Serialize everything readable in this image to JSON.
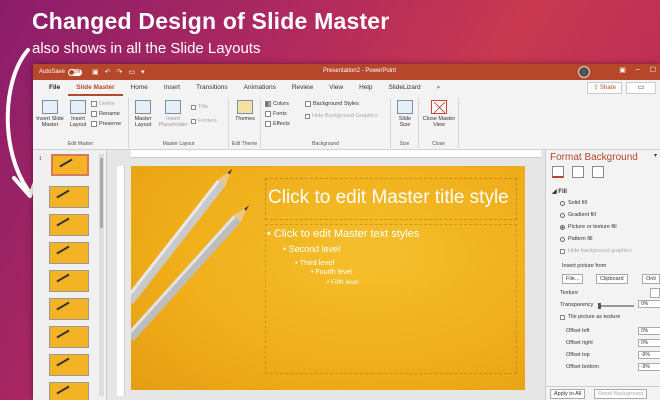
{
  "overlay": {
    "headline": "Changed Design of Slide Master",
    "subline": "also shows in all the Slide Layouts"
  },
  "titlebar": {
    "autosave_label": "AutoSave",
    "autosave_state": "Off",
    "doc_title": "Presentation2 - PowerPoint"
  },
  "tabs": [
    "File",
    "Slide Master",
    "Home",
    "Insert",
    "Transitions",
    "Animations",
    "Review",
    "View",
    "Help",
    "SlideLizard"
  ],
  "tell_me": "",
  "share_label": "Share",
  "ribbon": {
    "edit_master": {
      "label": "Edit Master",
      "insert_slide_master": "Insert Slide Master",
      "insert_layout": "Insert Layout",
      "delete": "Delete",
      "rename": "Rename",
      "preserve": "Preserve"
    },
    "master_layout": {
      "label": "Master Layout",
      "master_layout": "Master Layout",
      "insert_placeholder": "Insert Placeholder",
      "title": "Title",
      "footers": "Footers"
    },
    "edit_theme": {
      "label": "Edit Theme",
      "themes": "Themes"
    },
    "background": {
      "label": "Background",
      "colors": "Colors",
      "fonts": "Fonts",
      "effects": "Effects",
      "background_styles": "Background Styles",
      "hide_background_graphics": "Hide Background Graphics"
    },
    "size": {
      "label": "Size",
      "slide_size": "Slide Size"
    },
    "close": {
      "label": "Close",
      "close_master_view": "Close Master View"
    }
  },
  "slide": {
    "title": "Click to edit Master title style",
    "levels": [
      "Click to edit Master text styles",
      "Second level",
      "Third level",
      "Fourth level",
      "Fifth level"
    ],
    "footer_left": "",
    "footer_mid": "",
    "footer_right": ""
  },
  "thumb_number": "1",
  "panel": {
    "title": "Format Background",
    "fill_heading": "Fill",
    "solid_fill": "Solid fill",
    "gradient_fill": "Gradient fill",
    "picture_fill": "Picture or texture fill",
    "pattern_fill": "Pattern fill",
    "hide_bg_graphics": "Hide background graphics",
    "insert_picture_from": "Insert picture from",
    "file_btn": "File...",
    "clipboard_btn": "Clipboard",
    "online_btn": "Onli",
    "texture": "Texture",
    "transparency": "Transparency",
    "transparency_value": "0%",
    "tile_picture": "Tile picture as texture",
    "offset_left": "Offset left",
    "offset_left_value": "0%",
    "offset_right": "Offset right",
    "offset_right_value": "0%",
    "offset_top": "Offset top",
    "offset_top_value": "-9%",
    "offset_bottom": "Offset bottom",
    "offset_bottom_value": "-9%",
    "apply_to_all": "Apply to All",
    "reset_background": "Reset Background"
  },
  "colors": {
    "accent": "#b7472a",
    "slide_bg": "#efad19",
    "overlay_bg": "#b02a5e"
  }
}
